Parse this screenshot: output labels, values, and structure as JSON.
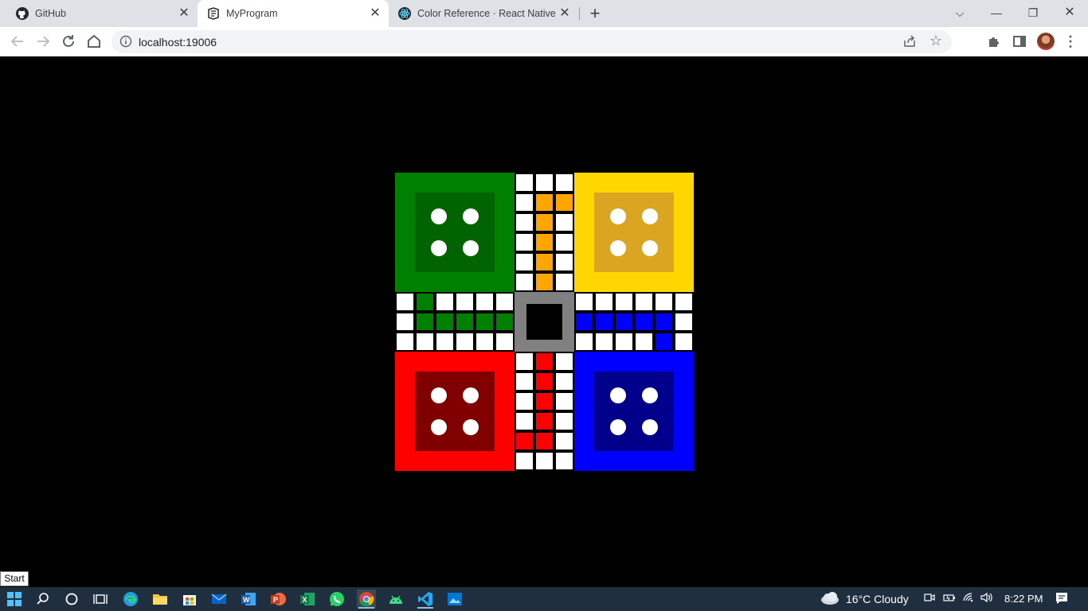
{
  "browser": {
    "tabs": [
      {
        "title": "GitHub",
        "icon": "github-icon",
        "active": false
      },
      {
        "title": "MyProgram",
        "icon": "expo-icon",
        "active": true
      },
      {
        "title": "Color Reference · React Native",
        "icon": "react-icon",
        "active": false
      }
    ],
    "url": "localhost:19006"
  },
  "board": {
    "homes": {
      "top_left": {
        "outer": "#008000",
        "inner": "#006400"
      },
      "top_right": {
        "outer": "#FFD700",
        "inner": "#DAA520"
      },
      "bottom_left": {
        "outer": "#FF0000",
        "inner": "#800000"
      },
      "bottom_right": {
        "outer": "#0000FF",
        "inner": "#00008B"
      }
    },
    "center_color": "#808080",
    "path_colors": {
      "orange": "#FFA500",
      "green": "#008000",
      "red": "#FF0000",
      "blue": "#0000FF"
    }
  },
  "taskbar": {
    "start_tooltip": "Start",
    "weather": "16°C  Cloudy",
    "time": "8:22 PM"
  }
}
